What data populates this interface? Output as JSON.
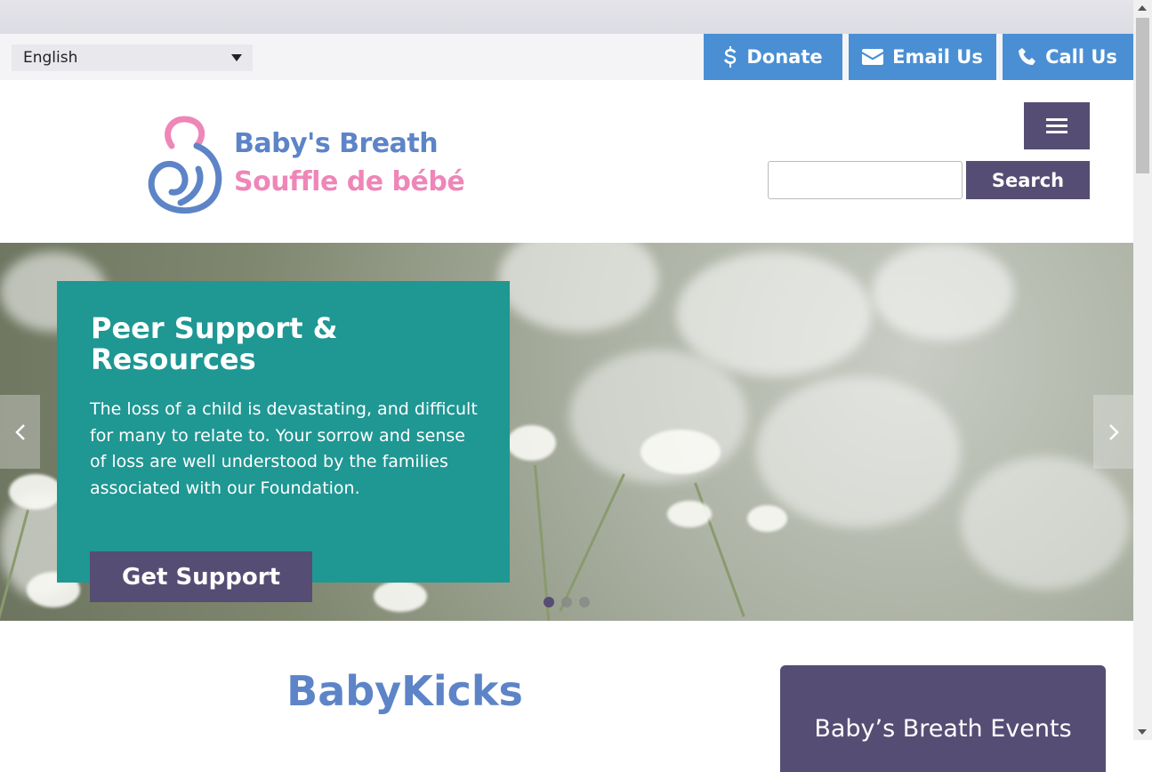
{
  "topbar": {
    "language": "English",
    "donate_label": "Donate",
    "email_label": "Email Us",
    "call_label": "Call Us"
  },
  "header": {
    "logo_line1": "Baby's Breath",
    "logo_line2": "Souffle de bébé",
    "search_placeholder": "",
    "search_label": "Search"
  },
  "hero": {
    "title": "Peer Support & Resources",
    "text": "The loss of a child is devastating, and difficult for many to relate to. Your sorrow and sense of loss are well understood by the families associated with our Foundation.",
    "button_label": "Get Support",
    "active_slide": 1,
    "slide_count": 3
  },
  "main": {
    "heading": "BabyKicks",
    "events_title": "Baby’s Breath Events"
  },
  "icons": {
    "donate": "dollar-icon",
    "email": "envelope-icon",
    "call": "phone-icon",
    "menu": "hamburger-icon",
    "prev": "chevron-left-icon",
    "next": "chevron-right-icon"
  },
  "colors": {
    "accent_blue": "#4a8fd4",
    "purple": "#554d73",
    "teal": "#1f9793",
    "logo_blue": "#5d84c7",
    "logo_pink": "#ee86b8"
  }
}
